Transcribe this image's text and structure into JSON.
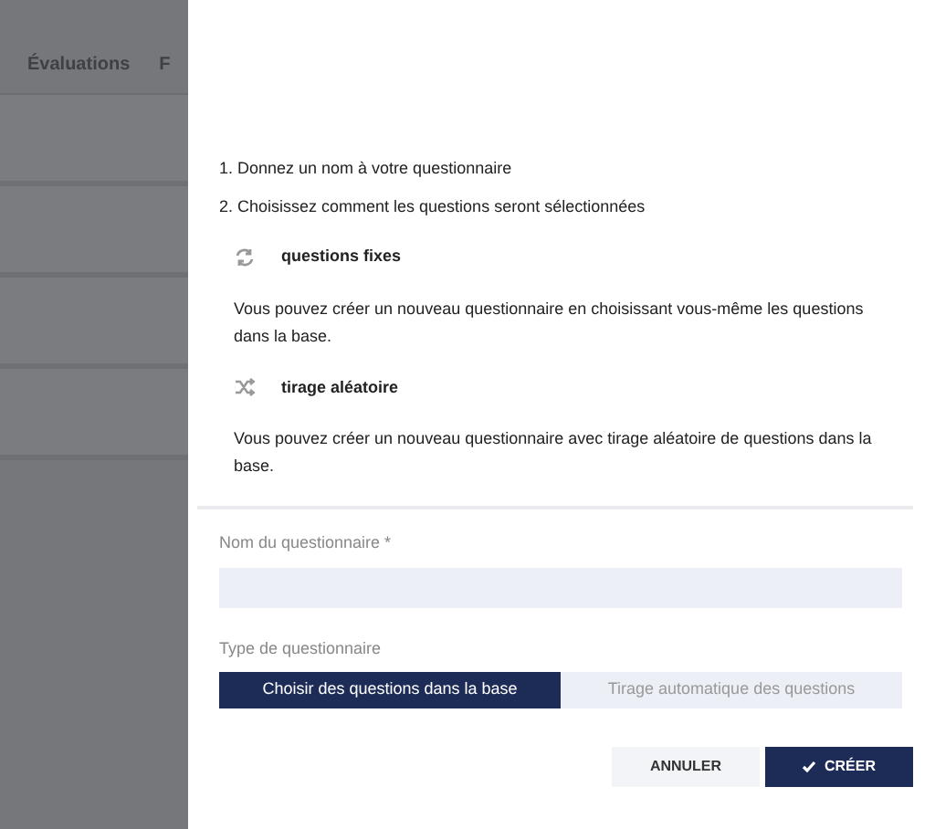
{
  "background": {
    "tabs": [
      {
        "label": "Évaluations"
      },
      {
        "label": "F"
      }
    ]
  },
  "panel": {
    "steps": [
      "1. Donnez un nom à votre questionnaire",
      "2. Choisissez comment les questions seront sélectionnées"
    ],
    "options": [
      {
        "kind": "fixed",
        "title": "questions fixes",
        "description": "Vous pouvez créer un nouveau questionnaire en choisissant vous-même les questions dans la base."
      },
      {
        "kind": "random",
        "title": "tirage aléatoire",
        "description": "Vous pouvez créer un nouveau questionnaire avec tirage aléatoire de questions dans la base."
      }
    ],
    "name_field": {
      "label": "Nom du questionnaire *"
    },
    "type_field": {
      "label": "Type de questionnaire",
      "choices": [
        {
          "label": "Choisir des questions dans la base",
          "selected": true
        },
        {
          "label": "Tirage automatique des questions",
          "selected": false
        }
      ]
    },
    "buttons": [
      {
        "kind": "cancel",
        "label": "ANNULER"
      },
      {
        "kind": "primary",
        "label": "CRÉER"
      }
    ]
  }
}
